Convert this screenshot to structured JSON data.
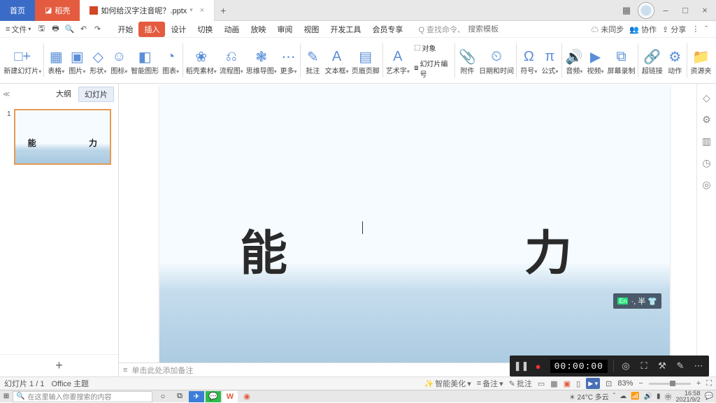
{
  "titlebar": {
    "home_tab": "首页",
    "daogao_tab": "稻壳",
    "file_tab": "如何给汉字注音呢？.pptx",
    "window_min": "–",
    "window_max": "□",
    "window_close": "×"
  },
  "menubar": {
    "file_menu": "文件",
    "ribbon_tabs": [
      "开始",
      "插入",
      "设计",
      "切换",
      "动画",
      "放映",
      "审阅",
      "视图",
      "开发工具",
      "会员专享"
    ],
    "active_tab_index": 1,
    "search_prefix": "Q 查找命令、",
    "search_placeholder": "搜索模板",
    "right": {
      "sync": "未同步",
      "collab": "协作",
      "share": "分享"
    }
  },
  "ribbon": [
    {
      "label": "新建幻灯片",
      "icon": "□+",
      "dd": true
    },
    {
      "label": "表格",
      "icon": "▦",
      "dd": true
    },
    {
      "label": "图片",
      "icon": "▣",
      "dd": true
    },
    {
      "label": "形状",
      "icon": "◇",
      "dd": true
    },
    {
      "label": "图标",
      "icon": "☺",
      "dd": true
    },
    {
      "label": "智能图形",
      "icon": "◧"
    },
    {
      "label": "图表",
      "icon": "◔",
      "dd": true
    },
    {
      "label": "稻壳素材",
      "icon": "❀",
      "dd": true
    },
    {
      "label": "流程图",
      "icon": "⎌",
      "dd": true
    },
    {
      "label": "思维导图",
      "icon": "❃",
      "dd": true
    },
    {
      "label": "更多",
      "icon": "⋯",
      "dd": true
    },
    {
      "label": "批注",
      "icon": "✎"
    },
    {
      "label": "文本框",
      "icon": "A",
      "dd": true
    },
    {
      "label": "页眉页脚",
      "icon": "▤"
    },
    {
      "label": "艺术字",
      "icon": "A",
      "dd": true
    },
    {
      "label": "附件",
      "icon": "📎"
    },
    {
      "label": "日期和时间",
      "icon": "⏲"
    },
    {
      "label": "符号",
      "icon": "Ω",
      "dd": true
    },
    {
      "label": "公式",
      "icon": "π",
      "dd": true
    },
    {
      "label": "音频",
      "icon": "🔊",
      "dd": true
    },
    {
      "label": "视频",
      "icon": "▶",
      "dd": true
    },
    {
      "label": "屏幕录制",
      "icon": "⧉"
    },
    {
      "label": "超链接",
      "icon": "🔗"
    },
    {
      "label": "动作",
      "icon": "⚙"
    },
    {
      "label": "资源夹",
      "icon": "📁"
    }
  ],
  "ribbon_extras": {
    "object": "对象",
    "slide_num": "幻灯片编号"
  },
  "outline": {
    "tab_outline": "大纲",
    "tab_slides": "幻灯片",
    "slide_number": "1",
    "t1": "能",
    "t2": "力",
    "add": "+"
  },
  "slide": {
    "big1": "能",
    "big2": "力",
    "ime_en": "En",
    "ime_rest": "·, 半 👕"
  },
  "notes": "单击此处添加备注",
  "statusbar": {
    "slide_count": "幻灯片 1 / 1",
    "theme": "Office 主题",
    "smart": "智能美化",
    "beizhu": "备注",
    "pizhu": "批注",
    "zoom": "83%"
  },
  "recbar": {
    "timer": "00:00:00"
  },
  "taskbar": {
    "search_placeholder": "在这里输入你要搜索的内容",
    "weather": "24°C 多云",
    "time": "16:58",
    "date": "2021/9/2"
  }
}
